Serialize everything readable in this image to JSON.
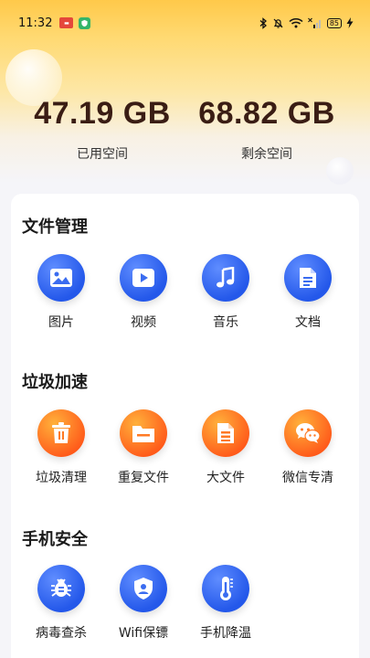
{
  "status_bar": {
    "time": "11:32",
    "battery": "85"
  },
  "storage": {
    "used": {
      "value": "47.19 GB",
      "label": "已用空间"
    },
    "free": {
      "value": "68.82 GB",
      "label": "剩余空间"
    }
  },
  "sections": {
    "files": {
      "title": "文件管理",
      "items": [
        {
          "label": "图片",
          "icon": "image-icon"
        },
        {
          "label": "视频",
          "icon": "video-icon"
        },
        {
          "label": "音乐",
          "icon": "music-icon"
        },
        {
          "label": "文档",
          "icon": "document-icon"
        }
      ]
    },
    "junk": {
      "title": "垃圾加速",
      "items": [
        {
          "label": "垃圾清理",
          "icon": "trash-icon"
        },
        {
          "label": "重复文件",
          "icon": "folder-icon"
        },
        {
          "label": "大文件",
          "icon": "large-file-icon"
        },
        {
          "label": "微信专清",
          "icon": "wechat-icon"
        }
      ]
    },
    "security": {
      "title": "手机安全",
      "items": [
        {
          "label": "病毒查杀",
          "icon": "virus-icon"
        },
        {
          "label": "Wifi保镖",
          "icon": "shield-user-icon"
        },
        {
          "label": "手机降温",
          "icon": "thermometer-icon"
        }
      ]
    }
  },
  "colors": {
    "blue": "#2458ea",
    "orange": "#ff5a1a",
    "header_yellow": "#ffc94a",
    "value_text": "#3a1d14"
  }
}
